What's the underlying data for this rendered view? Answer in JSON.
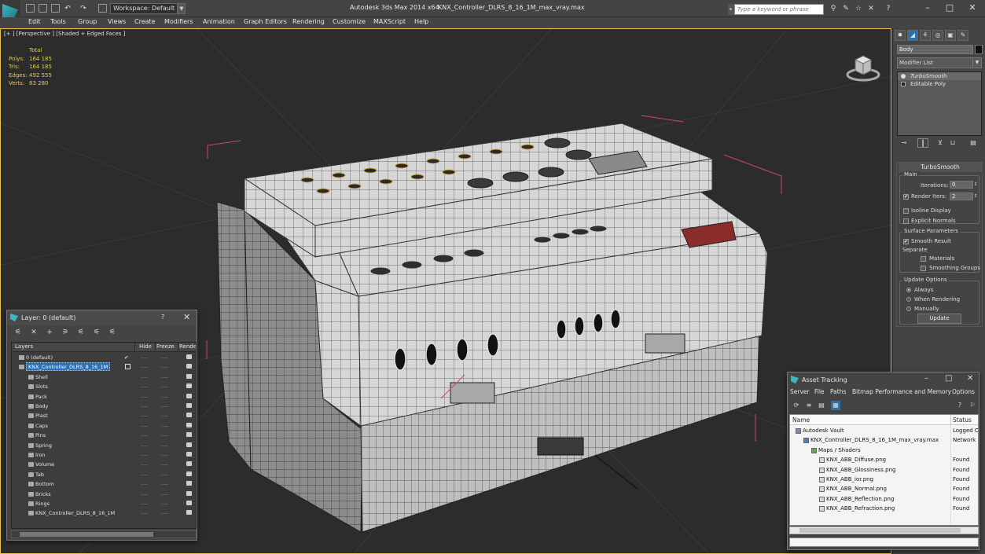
{
  "titlebar": {
    "workspace": "Workspace: Default",
    "app_title": "Autodesk 3ds Max  2014 x64",
    "file_name": "KNX_Controller_DLRS_8_16_1M_max_vray.max",
    "search_placeholder": "Type a keyword or phrase"
  },
  "menu": [
    "Edit",
    "Tools",
    "Group",
    "Views",
    "Create",
    "Modifiers",
    "Animation",
    "Graph Editors",
    "Rendering",
    "Customize",
    "MAXScript",
    "Help"
  ],
  "viewport": {
    "label": "[+ ] [Perspective ] [Shaded + Edged Faces ]",
    "stats": {
      "header": "Total",
      "rows": [
        {
          "key": "Polys:",
          "value": "164 185"
        },
        {
          "key": "Tris:",
          "value": "164 185"
        },
        {
          "key": "Edges:",
          "value": "492 555"
        },
        {
          "key": "Verts:",
          "value": "83 280"
        }
      ]
    }
  },
  "command_panel": {
    "object_name": "Body",
    "modifier_list": "Modifier List",
    "stack": [
      "TurboSmooth",
      "Editable Poly"
    ],
    "rollout_title": "TurboSmooth",
    "main_group": "Main",
    "iterations_label": "Iterations:",
    "iterations_value": "0",
    "render_iters_label": "Render Iters:",
    "render_iters_value": "2",
    "render_iters_checked": "✔",
    "isoline_label": "Isoline Display",
    "explicit_normals_label": "Explicit Normals",
    "surface_group": "Surface Parameters",
    "smooth_result_label": "Smooth Result",
    "smooth_result_checked": "✔",
    "separate_label": "Separate",
    "materials_label": "Materials",
    "smoothing_groups_label": "Smoothing Groups",
    "update_group": "Update Options",
    "always_label": "Always",
    "when_rendering_label": "When Rendering",
    "manually_label": "Manually",
    "update_button": "Update"
  },
  "layer_panel": {
    "title": "Layer: 0 (default)",
    "help": "?",
    "close": "✕",
    "columns": {
      "layers": "Layers",
      "hide": "Hide",
      "freeze": "Freeze",
      "render": "Render"
    },
    "default_layer": "0 (default)",
    "default_check": "✔",
    "selected_layer": "KNX_Controller_DLRS_8_16_1M",
    "children": [
      "Shell",
      "Slots",
      "Pack",
      "Body",
      "Plast",
      "Caps",
      "Pins",
      "Spring",
      "Iron",
      "Volume",
      "Tab",
      "Bottom",
      "Bricks",
      "Rings",
      "KNX_Controller_DLRS_8_16_1M"
    ],
    "dash": "----"
  },
  "asset_tracking": {
    "title": "Asset Tracking",
    "menu": [
      "Server",
      "File",
      "Paths",
      "Bitmap Performance and Memory",
      "Options"
    ],
    "columns": {
      "name": "Name",
      "status": "Status"
    },
    "rows": [
      {
        "name": "Autodesk Vault",
        "status": "Logged O",
        "indent": 0
      },
      {
        "name": "KNX_Controller_DLRS_8_16_1M_max_vray.max",
        "status": "Network F",
        "indent": 1
      },
      {
        "name": "Maps / Shaders",
        "status": "",
        "indent": 2
      },
      {
        "name": "KNX_ABB_Diffuse.png",
        "status": "Found",
        "indent": 3
      },
      {
        "name": "KNX_ABB_Glossiness.png",
        "status": "Found",
        "indent": 3
      },
      {
        "name": "KNX_ABB_ior.png",
        "status": "Found",
        "indent": 3
      },
      {
        "name": "KNX_ABB_Normal.png",
        "status": "Found",
        "indent": 3
      },
      {
        "name": "KNX_ABB_Reflection.png",
        "status": "Found",
        "indent": 3
      },
      {
        "name": "KNX_ABB_Refraction.png",
        "status": "Found",
        "indent": 3
      }
    ]
  },
  "colors": {
    "viewport_border": "#e8c248",
    "stats_text": "#e8c65a",
    "selection_blue": "#2f6fb6",
    "bbox_red": "#d0466a"
  }
}
